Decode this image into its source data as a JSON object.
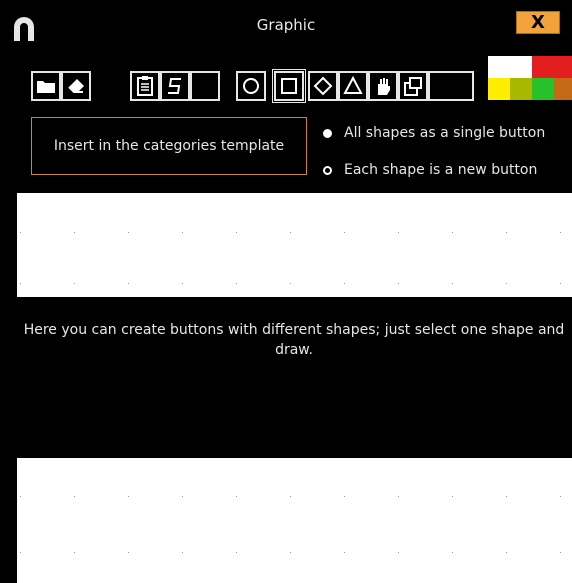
{
  "window": {
    "title": "Graphic",
    "close_label": "X",
    "app_icon": "magnet-icon"
  },
  "toolbar": {
    "file_tools": [
      {
        "icon": "folder-icon"
      },
      {
        "icon": "eraser-icon"
      }
    ],
    "edit_tools": [
      {
        "icon": "clipboard-icon"
      },
      {
        "icon": "sound-s-icon"
      },
      {
        "icon": "blank-icon"
      }
    ],
    "shape_tools": [
      {
        "icon": "circle-shape-icon"
      },
      {
        "icon": "square-shape-icon",
        "selected": true
      },
      {
        "icon": "diamond-shape-icon"
      },
      {
        "icon": "triangle-shape-icon"
      },
      {
        "icon": "hand-icon"
      },
      {
        "icon": "paste-icon"
      },
      {
        "icon": "blank-icon"
      }
    ]
  },
  "palette": [
    "#ffffff",
    "#ffffff",
    "#e31e1e",
    "#e31e1e",
    "#ffee00",
    "#a8b800",
    "#29c12a",
    "#c46a16"
  ],
  "template_button": "Insert in the categories template",
  "options": {
    "single": "All shapes as a single button",
    "each": "Each shape is a new button",
    "selected": "single"
  },
  "description": "Here you can create buttons with different shapes; just select one shape and draw."
}
